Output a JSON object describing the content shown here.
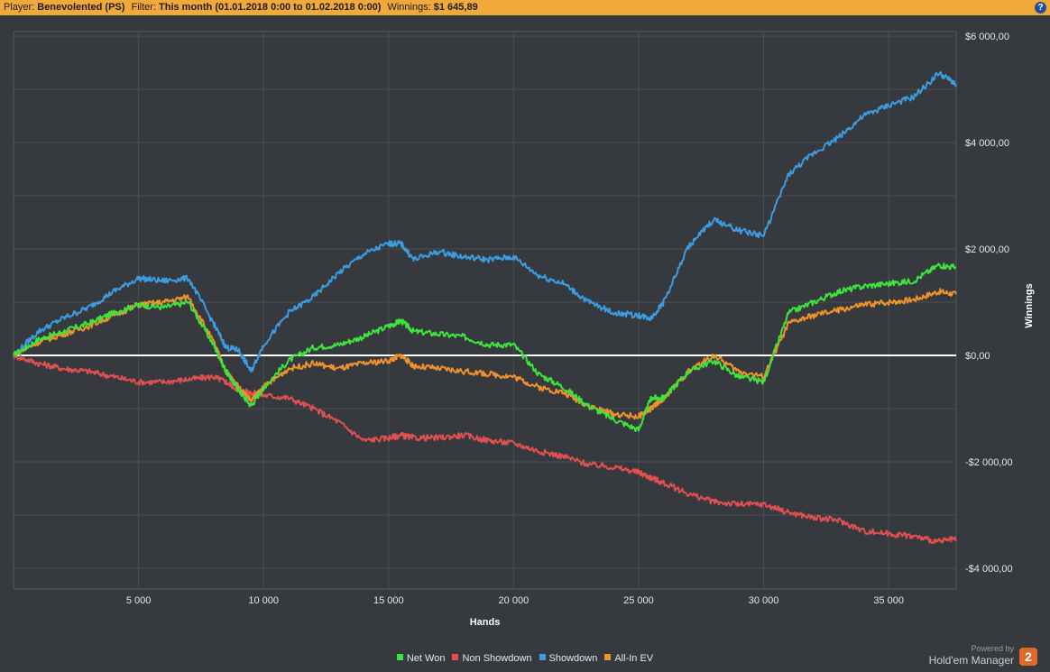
{
  "header": {
    "player_label": "Player:",
    "player_value": "Benevolented (PS)",
    "filter_label": "Filter:",
    "filter_value": "This month (01.01.2018 0:00 to 01.02.2018 0:00)",
    "winnings_label": "Winnings:",
    "winnings_value": "$1 645,89",
    "help_label": "?"
  },
  "brand": {
    "powered_by": "Powered by",
    "name": "Hold'em Manager",
    "logo": "2"
  },
  "colors": {
    "background": "#36393d",
    "header": "#f0a93a",
    "grid": "#4b4f54",
    "zero_line": "#ffffff"
  },
  "chart_data": {
    "type": "line",
    "xlabel": "Hands",
    "ylabel": "Winnings",
    "xlim": [
      0,
      37700
    ],
    "ylim": [
      -4500,
      6000
    ],
    "x_ticks": [
      5000,
      10000,
      15000,
      20000,
      25000,
      30000,
      35000
    ],
    "x_tick_labels": [
      "5 000",
      "10 000",
      "15 000",
      "20 000",
      "25 000",
      "30 000",
      "35 000"
    ],
    "y_ticks": [
      6000,
      4000,
      2000,
      0,
      -2000,
      -4000
    ],
    "y_tick_labels": [
      "$6 000,00",
      "$4 000,00",
      "$2 000,00",
      "$0,00",
      "-$2 000,00",
      "-$4 000,00"
    ],
    "grid": true,
    "legend_position": "bottom-center",
    "x": [
      0,
      1000,
      2000,
      3000,
      4000,
      5000,
      6000,
      7000,
      8000,
      8500,
      9000,
      9500,
      10000,
      11000,
      12000,
      13000,
      14000,
      15000,
      15500,
      16000,
      17000,
      18000,
      19000,
      20000,
      21000,
      22000,
      23000,
      24000,
      25000,
      25500,
      26000,
      27000,
      28000,
      29000,
      30000,
      31000,
      32000,
      33000,
      34000,
      35000,
      36000,
      37000,
      37700
    ],
    "series": [
      {
        "name": "Net Won",
        "color": "#3ee43e",
        "values": [
          0,
          300,
          450,
          600,
          800,
          950,
          900,
          1000,
          200,
          -300,
          -650,
          -950,
          -600,
          -100,
          150,
          200,
          350,
          550,
          650,
          450,
          400,
          350,
          200,
          200,
          -350,
          -600,
          -950,
          -1200,
          -1400,
          -800,
          -800,
          -300,
          -100,
          -400,
          -500,
          800,
          1000,
          1200,
          1300,
          1350,
          1400,
          1700,
          1650
        ]
      },
      {
        "name": "Non Showdown",
        "color": "#e05050",
        "values": [
          0,
          -150,
          -250,
          -300,
          -400,
          -500,
          -500,
          -450,
          -400,
          -500,
          -650,
          -700,
          -750,
          -800,
          -1000,
          -1250,
          -1600,
          -1550,
          -1500,
          -1550,
          -1550,
          -1500,
          -1600,
          -1650,
          -1800,
          -1900,
          -2050,
          -2100,
          -2200,
          -2300,
          -2400,
          -2600,
          -2750,
          -2800,
          -2800,
          -2950,
          -3050,
          -3100,
          -3300,
          -3350,
          -3400,
          -3500,
          -3450
        ]
      },
      {
        "name": "Showdown",
        "color": "#3d9be0",
        "values": [
          0,
          450,
          700,
          900,
          1200,
          1450,
          1400,
          1450,
          600,
          150,
          100,
          -300,
          200,
          800,
          1100,
          1550,
          1900,
          2100,
          2100,
          1800,
          1950,
          1850,
          1800,
          1850,
          1500,
          1350,
          1000,
          800,
          750,
          700,
          1000,
          2050,
          2550,
          2350,
          2250,
          3400,
          3800,
          4100,
          4500,
          4700,
          4850,
          5300,
          5100
        ]
      },
      {
        "name": "All-In EV",
        "color": "#f0922a",
        "values": [
          0,
          250,
          400,
          550,
          750,
          950,
          1000,
          1100,
          250,
          -300,
          -600,
          -850,
          -600,
          -250,
          -150,
          -250,
          -150,
          -100,
          0,
          -200,
          -250,
          -300,
          -350,
          -400,
          -600,
          -700,
          -950,
          -1100,
          -1150,
          -1000,
          -800,
          -300,
          0,
          -300,
          -400,
          600,
          750,
          850,
          950,
          1000,
          1050,
          1200,
          1150
        ]
      }
    ]
  }
}
